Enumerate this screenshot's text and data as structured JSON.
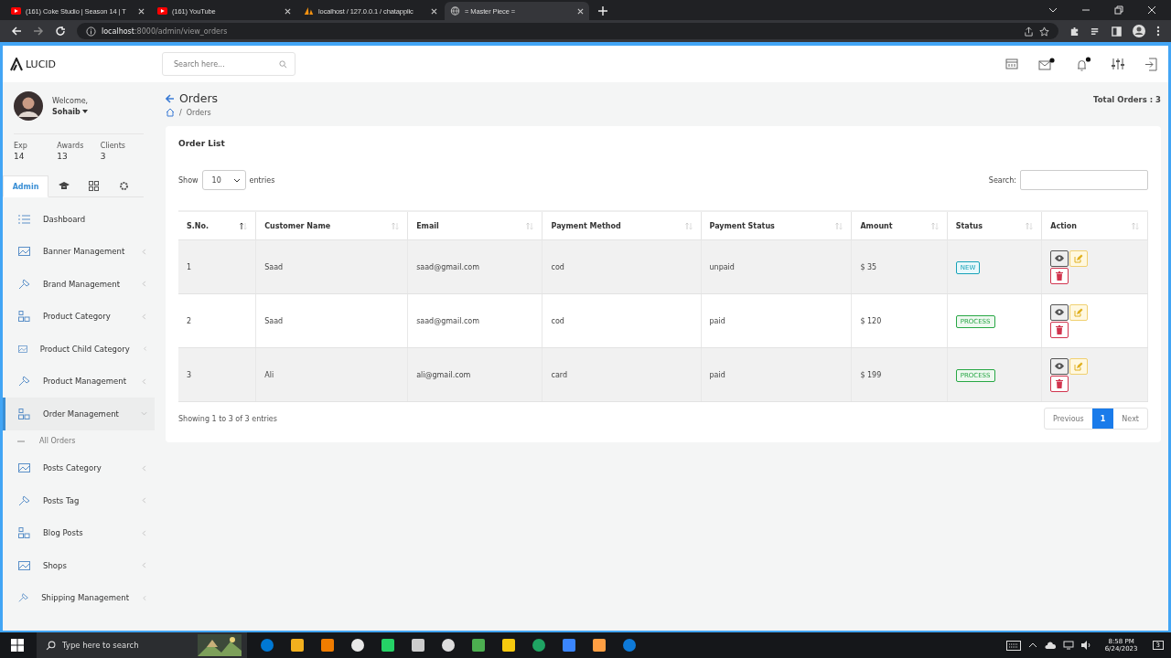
{
  "browser": {
    "tabs": [
      {
        "title": "(161) Coke Studio | Season 14 | T",
        "selected": false,
        "kind": "video"
      },
      {
        "title": "(161) YouTube",
        "selected": false,
        "kind": "video"
      },
      {
        "title": "localhost / 127.0.0.1 / chatapplic",
        "selected": false,
        "kind": "db"
      },
      {
        "title": "= Master Piece =",
        "selected": true,
        "kind": "globe"
      }
    ],
    "url": "**localhost**:8000/admin/view_orders"
  },
  "header": {
    "logo": "LUCID",
    "search": {
      "placeholder": "Search here..."
    },
    "mail_unread": true,
    "alerts_unread": true
  },
  "sidebar": {
    "welcome": "Welcome,",
    "user": "Sohaib",
    "stats": [
      {
        "label": "Exp",
        "value": "14"
      },
      {
        "label": "Awards",
        "value": "13"
      },
      {
        "label": "Clients",
        "value": "3"
      }
    ],
    "tabs": [
      {
        "label": "Admin",
        "selected": true
      },
      {
        "selected": false
      },
      {
        "selected": false
      },
      {
        "selected": false
      }
    ],
    "items": [
      {
        "label": "Dashboard",
        "kind": "link",
        "selected": false
      },
      {
        "label": "Banner Management",
        "kind": "menu",
        "expanded": false,
        "selected": false
      },
      {
        "label": "Brand Management",
        "kind": "menu",
        "expanded": false,
        "selected": false
      },
      {
        "label": "Product Category",
        "kind": "menu",
        "expanded": false,
        "selected": false
      },
      {
        "label": "Product Child Category",
        "kind": "menu",
        "expanded": false,
        "selected": false
      },
      {
        "label": "Product Management",
        "kind": "menu",
        "expanded": false,
        "selected": false
      },
      {
        "label": "Order Management",
        "kind": "menu",
        "expanded": true,
        "selected": true,
        "children": [
          {
            "label": "All Orders"
          }
        ]
      },
      {
        "label": "Posts Category",
        "kind": "menu",
        "expanded": false,
        "selected": false
      },
      {
        "label": "Posts Tag",
        "kind": "menu",
        "expanded": false,
        "selected": false
      },
      {
        "label": "Blog Posts",
        "kind": "menu",
        "expanded": false,
        "selected": false
      },
      {
        "label": "Shops",
        "kind": "menu",
        "expanded": false,
        "selected": false
      },
      {
        "label": "Shipping Management",
        "kind": "menu",
        "expanded": false,
        "selected": false
      }
    ]
  },
  "page": {
    "title": "Orders",
    "breadcrumb_separator": "/",
    "breadcrumb": "Orders",
    "total": "Total Orders : 3"
  },
  "card": {
    "title": "Order List",
    "show": "Show",
    "entries_value": "10",
    "entries": "entries",
    "search_label": "Search:",
    "table": {
      "columns": [
        {
          "label": "S.No.",
          "sorted": true
        },
        {
          "label": "Customer Name",
          "sorted": false
        },
        {
          "label": "Email",
          "sorted": false
        },
        {
          "label": "Payment Method",
          "sorted": false
        },
        {
          "label": "Payment Status",
          "sorted": false
        },
        {
          "label": "Amount",
          "sorted": false
        },
        {
          "label": "Status",
          "sorted": false
        },
        {
          "label": "Action",
          "sorted": false
        }
      ],
      "rows": [
        {
          "cells": [
            "1",
            "Saad",
            "saad@gmail.com",
            "cod",
            "unpaid",
            "$ 35"
          ],
          "status": {
            "label": "NEW",
            "kind": "new"
          }
        },
        {
          "cells": [
            "2",
            "Saad",
            "saad@gmail.com",
            "cod",
            "paid",
            "$ 120"
          ],
          "status": {
            "label": "PROCESS",
            "kind": "process"
          }
        },
        {
          "cells": [
            "3",
            "Ali",
            "ali@gmail.com",
            "card",
            "paid",
            "$ 199"
          ],
          "status": {
            "label": "PROCESS",
            "kind": "process"
          }
        }
      ]
    },
    "info": "Showing 1 to 3 of 3 entries",
    "pagination": [
      {
        "label": "Previous",
        "selected": false
      },
      {
        "label": "1",
        "selected": true
      },
      {
        "label": "Next",
        "selected": false
      }
    ]
  },
  "taskbar": {
    "search": {
      "placeholder": "Type here to search"
    },
    "time": "8:58 PM",
    "date": "6/24/2023",
    "notifications": "3"
  }
}
